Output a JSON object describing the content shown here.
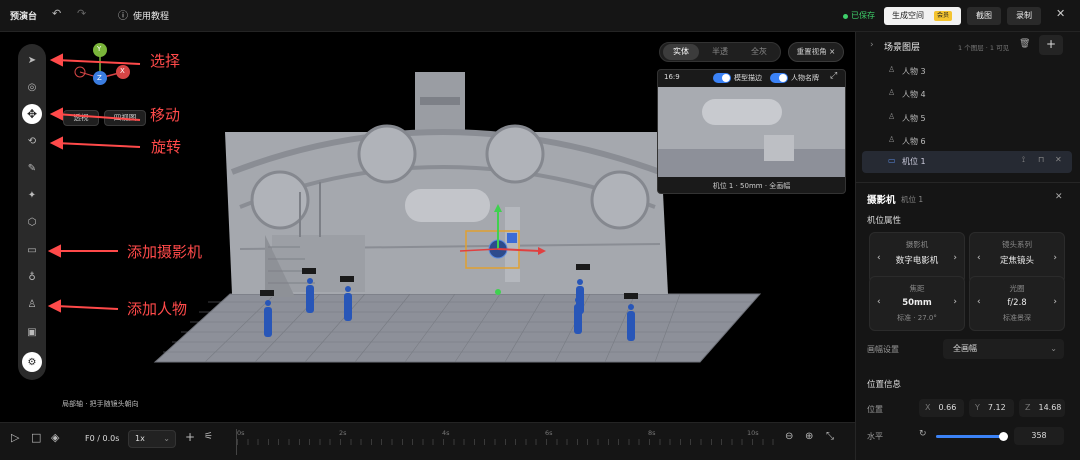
{
  "app": {
    "title": "预演台",
    "tutorial": "使用教程"
  },
  "top_right": {
    "saved": "已保存",
    "generate": "生成空间",
    "generate_badge": "会员",
    "screenshot": "截图",
    "record": "录制"
  },
  "callouts": {
    "select": "选择",
    "move": "移动",
    "rotate": "旋转",
    "add_camera": "添加摄影机",
    "add_person": "添加人物"
  },
  "viewport": {
    "view_tabs": [
      "实体",
      "半透",
      "全灰"
    ],
    "active_view_tab": "实体",
    "reset_view": "重置视角",
    "view_mode": "透视",
    "four_view": "四视图",
    "hint": "局部轴 · 把手随镜头朝向",
    "gizmo_axes": [
      "Y",
      "X",
      "Z"
    ],
    "preview": {
      "ratio": "16:9",
      "toggle_model_outline": "模型描边",
      "toggle_person_name": "人物名牌",
      "caption": "机位 1 · 50mm · 全画幅"
    },
    "figure_tag": "人物"
  },
  "timeline": {
    "frame": "F0 / 0.0s",
    "speed": "1x",
    "ticks": [
      "0s",
      "2s",
      "4s",
      "6s",
      "8s",
      "10s"
    ]
  },
  "scene_layers": {
    "title": "场景图层",
    "summary": "1 个图层 · 1 可见",
    "items": [
      "人物 3",
      "人物 4",
      "人物 5",
      "人物 6",
      "机位 1"
    ],
    "selected": "机位 1"
  },
  "camera_panel": {
    "title": "摄影机",
    "subtitle": "机位 1",
    "section_props": "机位属性",
    "camera": {
      "label": "摄影机",
      "value": "数字电影机"
    },
    "lens_series": {
      "label": "镜头系列",
      "value": "定焦镜头"
    },
    "focal": {
      "label": "焦距",
      "value": "50mm",
      "sub": "标准 · 27.0°"
    },
    "aperture": {
      "label": "光圈",
      "value": "f/2.8",
      "sub": "标准景深"
    },
    "frame_setting_label": "画幅设置",
    "frame_setting_value": "全画幅",
    "section_position": "位置信息",
    "position_label": "位置",
    "x": "0.66",
    "y": "7.12",
    "z": "14.68",
    "horizontal_label": "水平",
    "horizontal_value": "358",
    "horizontal_level": 0.96
  },
  "colors": {
    "accent": "#3b82f6",
    "callout": "#ff4a4a",
    "gizmo_y": "#7ab53a",
    "gizmo_x": "#d64545",
    "gizmo_z": "#3b7de0",
    "saved_dot": "#3ecf6a"
  }
}
